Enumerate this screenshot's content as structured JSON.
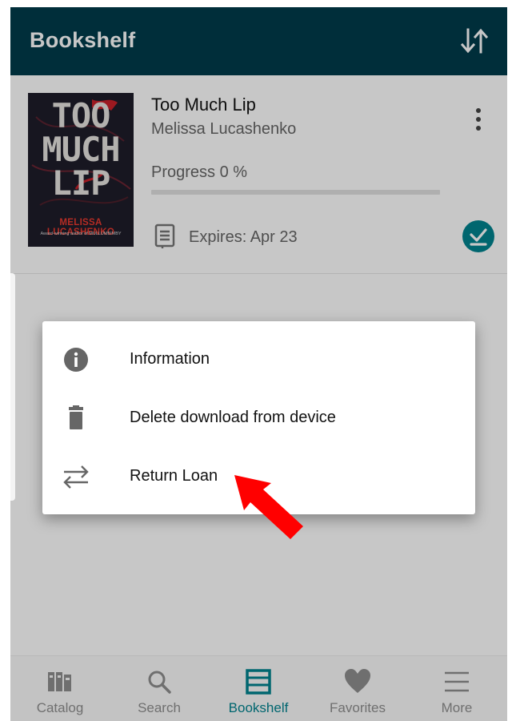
{
  "appbar": {
    "title": "Bookshelf",
    "sort_icon": "sort-arrows-icon"
  },
  "book": {
    "title": "Too Much Lip",
    "author": "Melissa Lucashenko",
    "progress_label": "Progress 0 %",
    "progress_fraction": 0,
    "expires": "Expires: Apr 23",
    "cover": {
      "title": "TOO MUCH LIP",
      "author": "MELISSA LUCASHENKO",
      "tagline": "Award-winning author of MULLUMBIMBY"
    }
  },
  "menu": {
    "items": [
      {
        "label": "Information",
        "icon": "info-icon"
      },
      {
        "label": "Delete download from device",
        "icon": "trash-icon"
      },
      {
        "label": "Return Loan",
        "icon": "swap-arrows-icon"
      }
    ]
  },
  "bottom_nav": {
    "items": [
      {
        "label": "Catalog",
        "icon": "books-icon",
        "active": false
      },
      {
        "label": "Search",
        "icon": "search-icon",
        "active": false
      },
      {
        "label": "Bookshelf",
        "icon": "bookshelf-icon",
        "active": true
      },
      {
        "label": "Favorites",
        "icon": "heart-icon",
        "active": false
      },
      {
        "label": "More",
        "icon": "hamburger-menu-icon",
        "active": false
      }
    ]
  },
  "colors": {
    "appbar": "#003c4b",
    "accent": "#00838f",
    "annotation": "#ff0000"
  }
}
